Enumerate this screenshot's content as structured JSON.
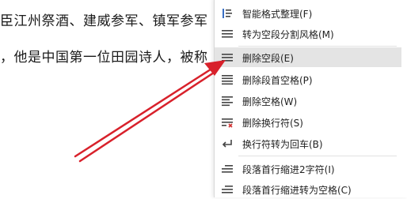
{
  "document": {
    "line1": "臣江州祭酒、建威参军、镇军参军",
    "line2": "，他是中国第一位田园诗人，被称"
  },
  "context_menu": {
    "items": [
      {
        "label": "智能格式整理(F)",
        "icon": "smart-format-icon"
      },
      {
        "label": "转为空段分割风格(M)",
        "icon": "paragraph-split-icon"
      },
      {
        "label": "删除空段(E)",
        "icon": "delete-empty-paragraph-icon"
      },
      {
        "label": "删除段首空格(P)",
        "icon": "delete-leading-space-icon"
      },
      {
        "label": "删除空格(W)",
        "icon": "delete-space-icon"
      },
      {
        "label": "删除换行符(S)",
        "icon": "delete-linebreak-icon"
      },
      {
        "label": "换行符转为回车(B)",
        "icon": "linebreak-to-return-icon"
      },
      {
        "label": "段落首行缩进2字符(I)",
        "icon": "first-line-indent-icon"
      },
      {
        "label": "段落首行缩进转为空格(C)",
        "icon": "indent-to-space-icon"
      }
    ],
    "highlighted_index": 2
  },
  "annotation": {
    "arrow_color": "#d8212b"
  }
}
